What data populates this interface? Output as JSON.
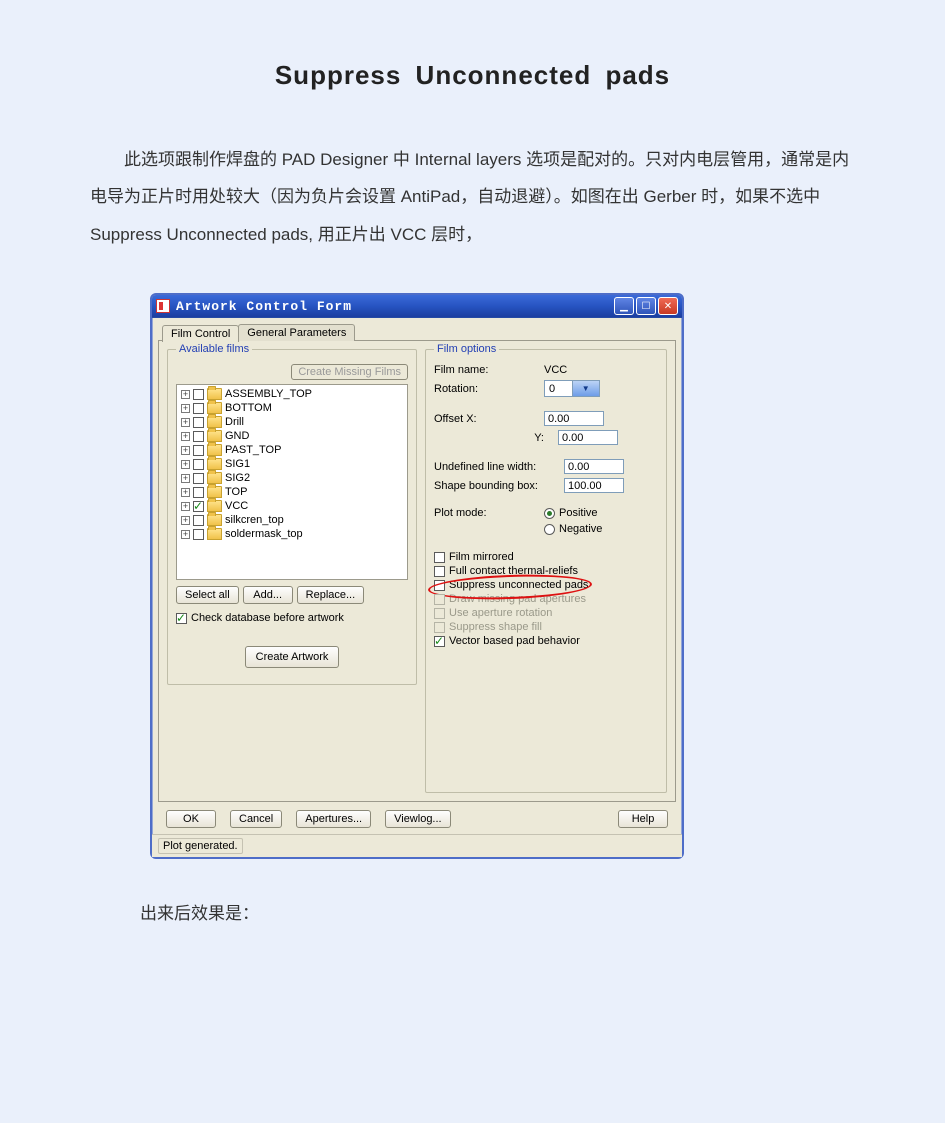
{
  "doc": {
    "title": "Suppress  Unconnected  pads",
    "para1": "此选项跟制作焊盘的 PAD  Designer 中 Internal  layers 选项是配对的。只对内电层管用，通常是内电导为正片时用处较大（因为负片会设置  AntiPad，自动退避）。如图在出 Gerber 时，如果不选中  Suppress  Unconnected  pads, 用正片出 VCC   层时，",
    "result_label": "出来后效果是："
  },
  "window": {
    "title": "Artwork Control Form",
    "tabs": {
      "film_control": "Film Control",
      "general_params": "General Parameters"
    },
    "left": {
      "group_label": "Available films",
      "create_missing": "Create Missing Films",
      "films": [
        {
          "name": "ASSEMBLY_TOP",
          "checked": false
        },
        {
          "name": "BOTTOM",
          "checked": false
        },
        {
          "name": "Drill",
          "checked": false
        },
        {
          "name": "GND",
          "checked": false
        },
        {
          "name": "PAST_TOP",
          "checked": false
        },
        {
          "name": "SIG1",
          "checked": false
        },
        {
          "name": "SIG2",
          "checked": false
        },
        {
          "name": "TOP",
          "checked": false
        },
        {
          "name": "VCC",
          "checked": true
        },
        {
          "name": "silkcren_top",
          "checked": false
        },
        {
          "name": "soldermask_top",
          "checked": false
        }
      ],
      "select_all": "Select all",
      "add": "Add...",
      "replace": "Replace...",
      "check_db": "Check database before artwork",
      "create_artwork": "Create Artwork"
    },
    "right": {
      "group_label": "Film options",
      "film_name_lbl": "Film name:",
      "film_name_val": "VCC",
      "rotation_lbl": "Rotation:",
      "rotation_val": "0",
      "offset_x_lbl": "Offset  X:",
      "offset_x_val": "0.00",
      "offset_y_lbl": "Y:",
      "offset_y_val": "0.00",
      "undef_lw_lbl": "Undefined line width:",
      "undef_lw_val": "0.00",
      "shape_bb_lbl": "Shape bounding box:",
      "shape_bb_val": "100.00",
      "plot_mode_lbl": "Plot mode:",
      "positive": "Positive",
      "negative": "Negative",
      "film_mirrored": "Film mirrored",
      "full_contact": "Full contact thermal-reliefs",
      "suppress_unconnected": "Suppress unconnected pads",
      "draw_missing": "Draw missing pad apertures",
      "use_aperture_rot": "Use aperture rotation",
      "suppress_shape": "Suppress shape fill",
      "vector_based": "Vector based pad behavior"
    },
    "bottom": {
      "ok": "OK",
      "cancel": "Cancel",
      "apertures": "Apertures...",
      "viewlog": "Viewlog...",
      "help": "Help"
    },
    "status": "Plot generated."
  }
}
